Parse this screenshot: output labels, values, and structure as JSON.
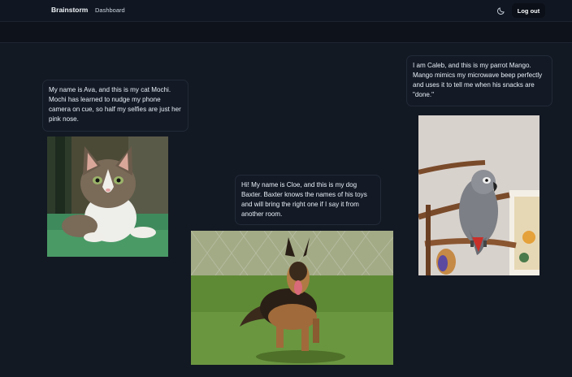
{
  "nav": {
    "brand": "Brainstorm",
    "dashboard_link": "Dashboard",
    "theme_icon": "moon-icon",
    "logout_label": "Log out"
  },
  "posts": [
    {
      "text": "My name is Ava, and this is my cat Mochi. Mochi has learned to nudge my phone camera on cue, so half my selfies are just her pink nose."
    },
    {
      "text": "Hi! My name is Cloe, and this is my dog Baxter. Baxter knows the names of his toys and will bring the right one if I say it from another room."
    },
    {
      "text": "I am Caleb, and this is my parrot Mango. Mango mimics my microwave beep perfectly and uses it to tell me when his snacks are \"done.\""
    }
  ],
  "colors": {
    "background": "#131923",
    "card": "#131a26",
    "card_border": "#222a38"
  }
}
